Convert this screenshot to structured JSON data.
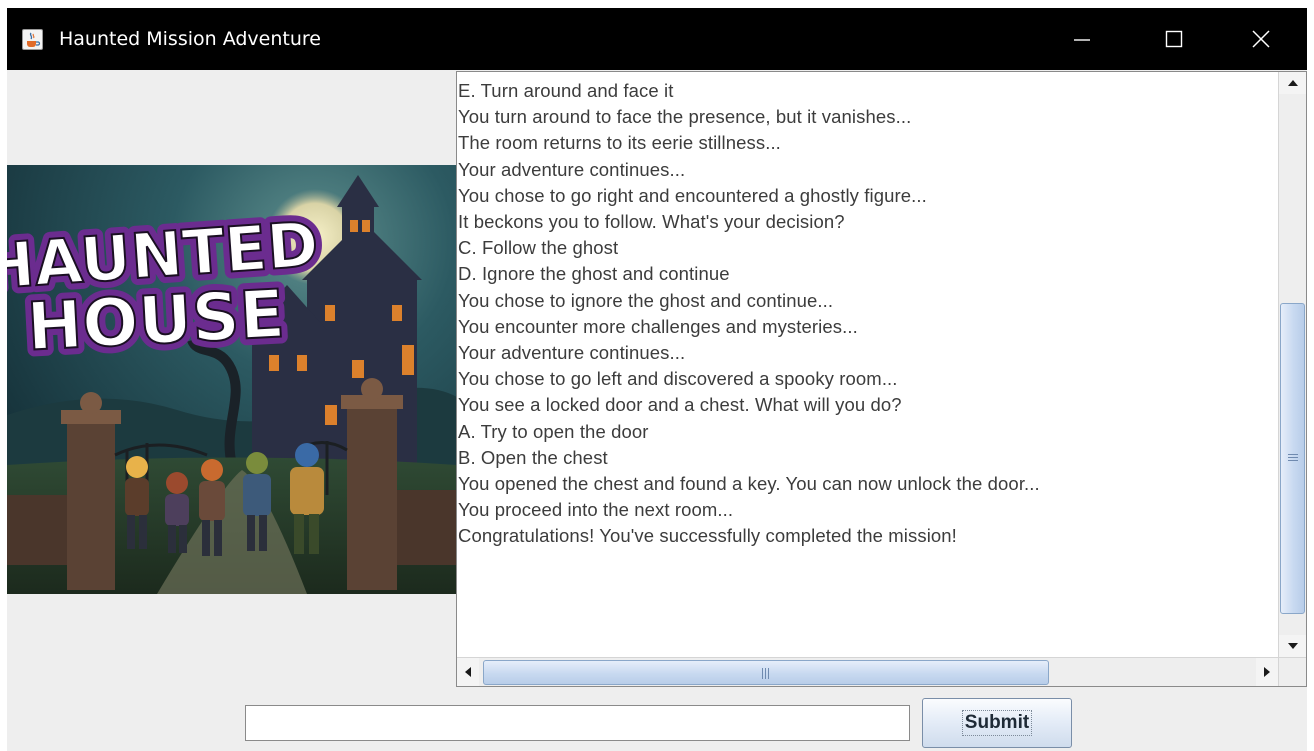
{
  "window": {
    "title": "Haunted Mission Adventure",
    "icon": "java-coffee-cup-icon",
    "controls": [
      "minimize-icon",
      "maximize-icon",
      "close-icon"
    ]
  },
  "poster": {
    "logo_text": "HAUNTED HOUSE",
    "colors": {
      "sky": "#1f4a54",
      "logo_fill": "#ffffff",
      "logo_outline": "#6b2c8f",
      "window_glow": "#f08a2a"
    }
  },
  "log": {
    "lines": [
      "E. Turn around and face it",
      "You turn around to face the presence, but it vanishes...",
      "The room returns to its eerie stillness...",
      "Your adventure continues...",
      "You chose to go right and encountered a ghostly figure...",
      "It beckons you to follow. What's your decision?",
      "C. Follow the ghost",
      "D. Ignore the ghost and continue",
      "You chose to ignore the ghost and continue...",
      "You encounter more challenges and mysteries...",
      "Your adventure continues...",
      "You chose to go left and discovered a spooky room...",
      "You see a locked door and a chest. What will you do?",
      "A. Try to open the door",
      "B. Open the chest",
      "You opened the chest and found a key. You can now unlock the door...",
      "You proceed into the next room...",
      "Congratulations! You've successfully completed the mission!"
    ]
  },
  "input": {
    "value": "",
    "placeholder": ""
  },
  "submit": {
    "label": "Submit"
  },
  "scroll": {
    "vertical_position": 0.4,
    "vertical_visible_fraction": 0.55,
    "horizontal_visible_fraction": 0.7
  }
}
